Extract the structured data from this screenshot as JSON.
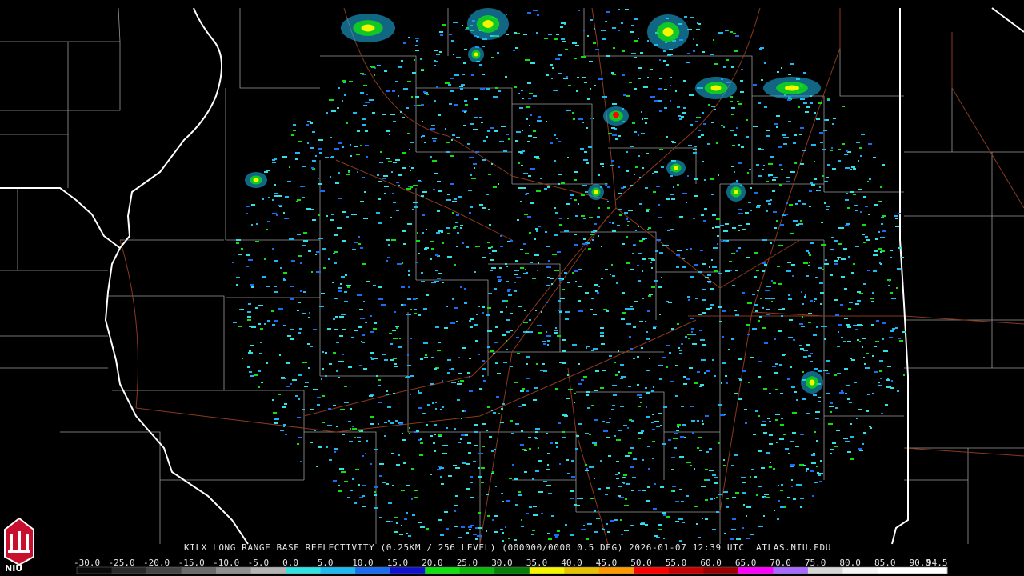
{
  "product": {
    "caption": "KILX LONG RANGE BASE REFLECTIVITY (0.25KM / 256 LEVEL) (000000/0000 0.5 DEG) 2026-01-07 12:39 UTC  ATLAS.NIU.EDU"
  },
  "logo": {
    "text": "NIU"
  },
  "legend": {
    "ticks": [
      "-30.0",
      "-25.0",
      "-20.0",
      "-15.0",
      "-10.0",
      "-5.0",
      "0.0",
      "5.0",
      "10.0",
      "15.0",
      "20.0",
      "25.0",
      "30.0",
      "35.0",
      "40.0",
      "45.0",
      "50.0",
      "55.0",
      "60.0",
      "65.0",
      "70.0",
      "75.0",
      "80.0",
      "85.0",
      "90.0",
      "94.5"
    ],
    "colors": [
      "#0a0a0a",
      "#2a2a2a",
      "#454545",
      "#6a6a6a",
      "#8f8f8f",
      "#b3b3b3",
      "#32e2e2",
      "#1fb9f0",
      "#1a6cf0",
      "#1010d0",
      "#10e010",
      "#0ab70a",
      "#067d06",
      "#f5f500",
      "#e8c200",
      "#ff9a00",
      "#ff0000",
      "#c80000",
      "#9a0000",
      "#ff00ff",
      "#a96bff",
      "#d6d6d6",
      "#f4f4f4",
      "#ffffff",
      "#ffffff"
    ]
  },
  "colors": {
    "state_border": "#ffffff",
    "county_border": "#9a9a9a",
    "roads": "#8a3a1e",
    "background": "#000000"
  }
}
